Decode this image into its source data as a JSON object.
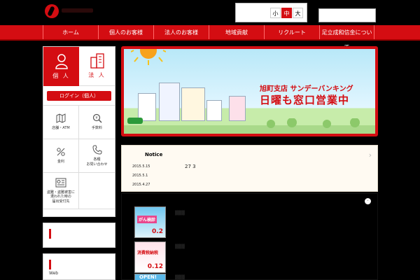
{
  "header": {
    "font_size": {
      "small": "小",
      "medium": "中",
      "large": "大"
    },
    "search_placeholder": ""
  },
  "nav": {
    "items": [
      "ホーム",
      "個人のお客様",
      "法人のお客様",
      "地域貢献",
      "リクルート",
      "足立成和信金について"
    ]
  },
  "sidebar": {
    "tab_personal": "個 人",
    "tab_corporate": "法 人",
    "login_label": "ログイン（個人）",
    "grid": [
      {
        "label": "店舗・ATM",
        "icon": "map-icon"
      },
      {
        "label": "手数料",
        "icon": "search-yen-icon"
      },
      {
        "label": "金利",
        "icon": "percent-icon"
      },
      {
        "label": "各種\nお問い合わせ",
        "icon": "phone-icon"
      },
      {
        "label": "盗難・盗難被害に\n遭われた時の\n届出受付先",
        "icon": "id-card-icon"
      }
    ],
    "web_label": "Web"
  },
  "banner": {
    "line1": "旭町支店 サンデーバンキング",
    "line2": "日曜も窓口営業中"
  },
  "notice": {
    "title": "Notice",
    "items": [
      {
        "date": "2015.5.15",
        "text": "27 3"
      },
      {
        "date": "2015.5.1",
        "text": ""
      },
      {
        "date": "2015.4.27",
        "text": ""
      }
    ]
  },
  "feature": {
    "thumb1_text": "がん検診",
    "thumb1_value": "0.2",
    "thumb2_text": "消費税納税",
    "thumb2_value": "0.12",
    "thumb3_text": "OPEN!"
  },
  "colors": {
    "brand": "#d40d12"
  }
}
